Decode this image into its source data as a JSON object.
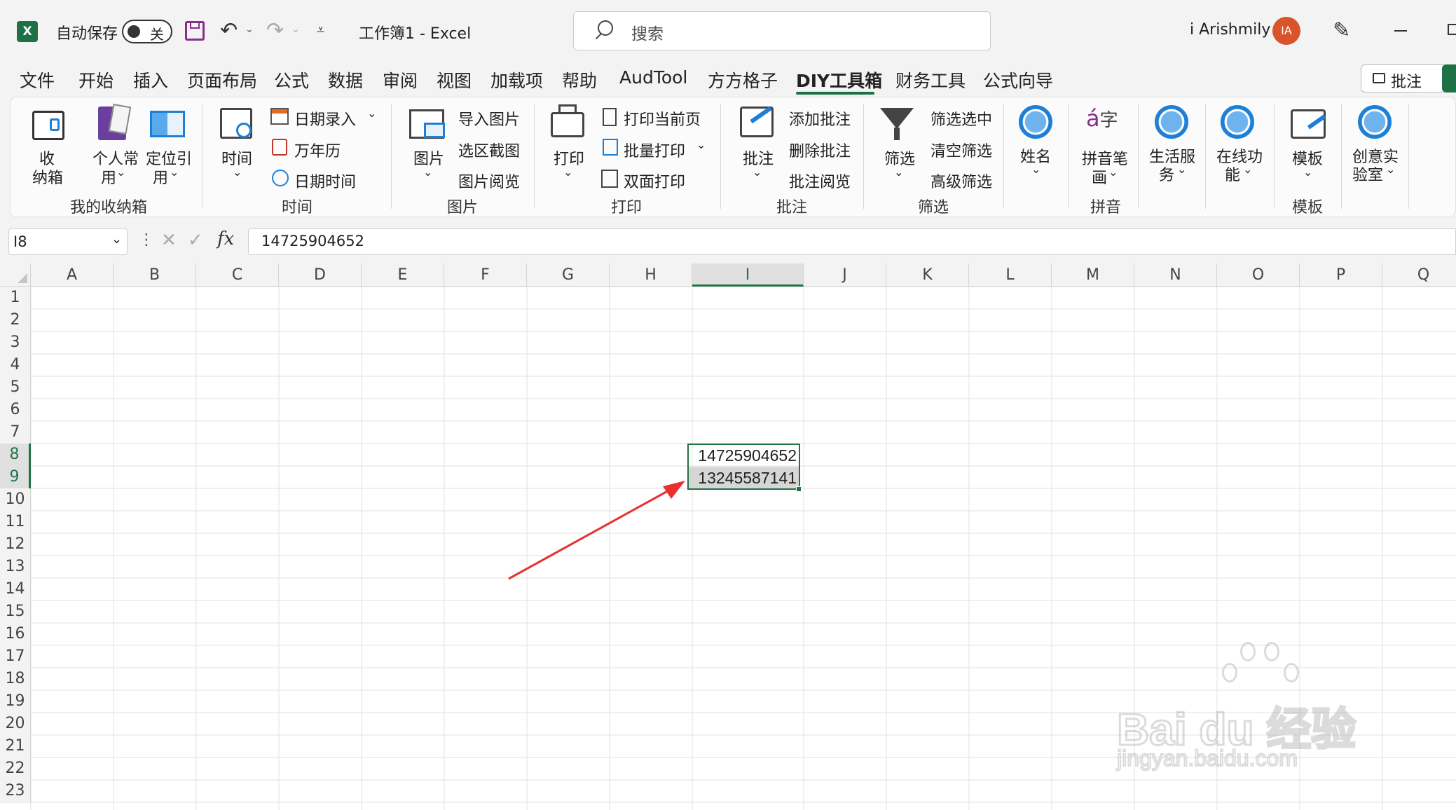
{
  "title_bar": {
    "autosave_label": "自动保存",
    "autosave_state": "关",
    "document_title": "工作簿1  -  Excel",
    "search_placeholder": "搜索",
    "user_name": "i Arishmily",
    "user_initials": "IA"
  },
  "menu": {
    "tabs": [
      "文件",
      "开始",
      "插入",
      "页面布局",
      "公式",
      "数据",
      "审阅",
      "视图",
      "加载项",
      "帮助",
      "AudTool",
      "方方格子",
      "DIY工具箱",
      "财务工具",
      "公式向导"
    ],
    "active_tab": "DIY工具箱",
    "comment_button": "批注"
  },
  "ribbon": {
    "groups": {
      "storage": "我的收纳箱",
      "time": "时间",
      "picture": "图片",
      "print": "打印",
      "comment": "批注",
      "filter": "筛选",
      "pinyin": "拼音",
      "template": "模板"
    },
    "storage_btn": [
      "收",
      "纳箱"
    ],
    "personal_btn": [
      "个人常",
      "用"
    ],
    "locate_btn": [
      "定位引",
      "用"
    ],
    "time_btn": "时间",
    "date_entry": "日期录入",
    "calendar": "万年历",
    "datetime": "日期时间",
    "picture_btn": "图片",
    "import_picture": "导入图片",
    "area_screenshot": "选区截图",
    "picture_browse": "图片阅览",
    "print_btn": "打印",
    "print_current": "打印当前页",
    "batch_print": "批量打印",
    "duplex_print": "双面打印",
    "comment_btn": "批注",
    "add_comment": "添加批注",
    "delete_comment": "删除批注",
    "browse_comment": "批注阅览",
    "filter_btn": "筛选",
    "filter_selected": "筛选选中",
    "clear_filter": "清空筛选",
    "advanced_filter": "高级筛选",
    "name_btn": "姓名",
    "pinyin_btn": [
      "拼音笔",
      "画"
    ],
    "life_btn": [
      "生活服",
      "务"
    ],
    "online_btn": [
      "在线功",
      "能"
    ],
    "template_btn": "模板",
    "creative_btn": [
      "创意实",
      "验室"
    ]
  },
  "formula_bar": {
    "name_box": "I8",
    "fx": "fx",
    "value": "14725904652"
  },
  "sheet": {
    "columns": [
      "A",
      "B",
      "C",
      "D",
      "E",
      "F",
      "G",
      "H",
      "I",
      "J",
      "K",
      "L",
      "M",
      "N",
      "O",
      "P",
      "Q"
    ],
    "rows": [
      "1",
      "2",
      "3",
      "4",
      "5",
      "6",
      "7",
      "8",
      "9",
      "10",
      "11",
      "12",
      "13",
      "14",
      "15",
      "16",
      "17",
      "18",
      "19",
      "20",
      "21",
      "22",
      "23"
    ],
    "cells": {
      "I8": "14725904652",
      "I9": "13245587141"
    },
    "selected_column": "I"
  },
  "watermark": {
    "text": "Bai du 经验",
    "url": "jingyan.baidu.com"
  },
  "colors": {
    "excel_green": "#1e7145",
    "selection_green": "#217346",
    "arrow_red": "#e8312f",
    "avatar_orange": "#d9542b"
  }
}
